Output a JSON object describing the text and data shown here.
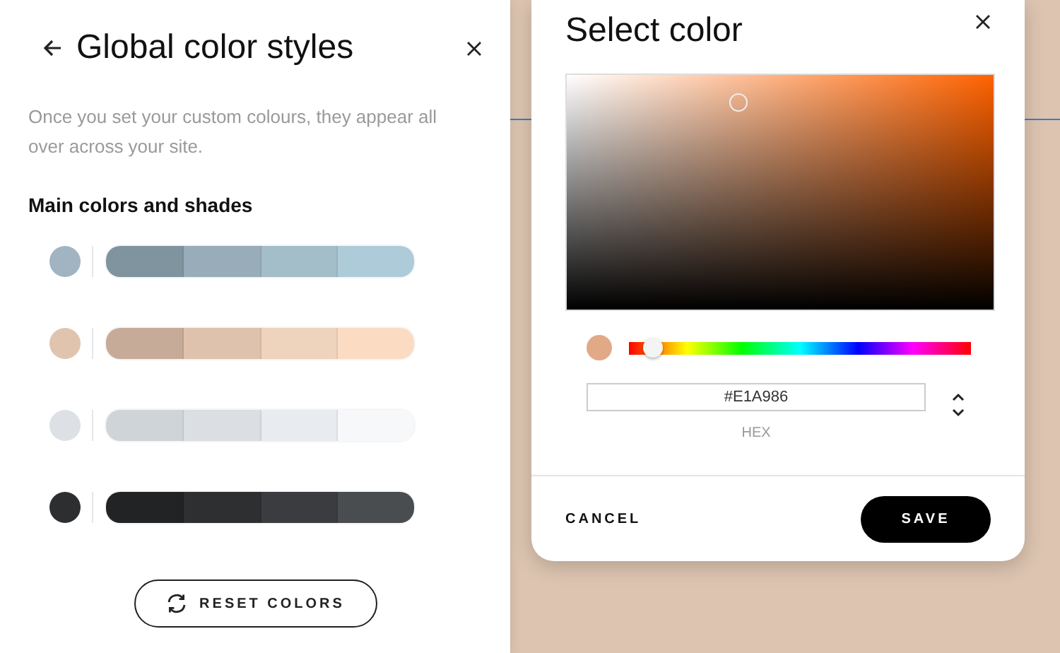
{
  "panel": {
    "title": "Global color styles",
    "description": "Once you set your custom colours, they appear all over across your site.",
    "section_title": "Main colors and shades",
    "palettes": [
      {
        "color": "#a0b4c2",
        "shades": [
          {
            "color": "#7f949e"
          },
          {
            "color": "#98adb9"
          },
          {
            "color": "#a3bdc9"
          },
          {
            "color": "#adcbd8"
          }
        ]
      },
      {
        "color": "#e0c4ae",
        "shades": [
          {
            "color": "#c6ab98"
          },
          {
            "color": "#dfc2ad"
          },
          {
            "color": "#eed3bd"
          },
          {
            "color": "#fbdbc2"
          }
        ]
      },
      {
        "color": "#dde0e5",
        "shades": [
          {
            "color": "#cfd4d8"
          },
          {
            "color": "#dbdee3"
          },
          {
            "color": "#e8ebf0"
          },
          {
            "color": "#f7f8fa"
          }
        ]
      },
      {
        "color": "#2d2e30",
        "shades": [
          {
            "color": "#222324"
          },
          {
            "color": "#2e2f31"
          },
          {
            "color": "#3b3c3f"
          },
          {
            "color": "#4a4d50"
          }
        ]
      }
    ],
    "reset_button": "RESET COLORS"
  },
  "dialog": {
    "title": "Select color",
    "hue_slider": {
      "level": 0.07
    },
    "hex_value": "#E1A986",
    "hex_label": "HEX",
    "cancel": "CANCEL",
    "save": "SAVE"
  }
}
